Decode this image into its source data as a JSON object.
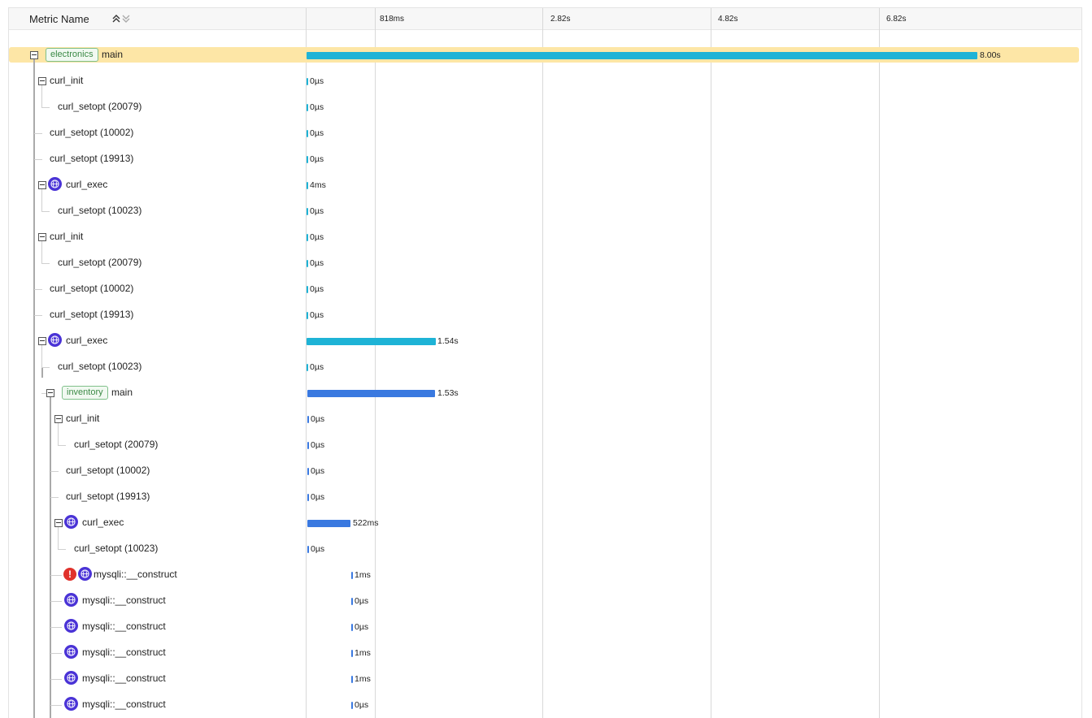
{
  "header": {
    "column_label": "Metric Name",
    "ticks": [
      "818ms",
      "2.82s",
      "4.82s",
      "6.82s"
    ]
  },
  "colors": {
    "bar_primary": "#1eb3d6",
    "bar_secondary": "#3a79e0",
    "highlight": "#fde6a6",
    "tag": "#7fc08a"
  },
  "rows": [
    {
      "tag": "electronics",
      "label": "main",
      "duration": "8.00s"
    },
    {
      "label": "curl_init",
      "duration": "0µs"
    },
    {
      "label": "curl_setopt (20079)",
      "duration": "0µs"
    },
    {
      "label": "curl_setopt (10002)",
      "duration": "0µs"
    },
    {
      "label": "curl_setopt (19913)",
      "duration": "0µs"
    },
    {
      "icon": "globe-icon",
      "label": "curl_exec",
      "duration": "4ms"
    },
    {
      "label": "curl_setopt (10023)",
      "duration": "0µs"
    },
    {
      "label": "curl_init",
      "duration": "0µs"
    },
    {
      "label": "curl_setopt (20079)",
      "duration": "0µs"
    },
    {
      "label": "curl_setopt (10002)",
      "duration": "0µs"
    },
    {
      "label": "curl_setopt (19913)",
      "duration": "0µs"
    },
    {
      "icon": "globe-icon",
      "label": "curl_exec",
      "duration": "1.54s"
    },
    {
      "label": "curl_setopt (10023)",
      "duration": "0µs"
    },
    {
      "tag": "inventory",
      "label": "main",
      "duration": "1.53s"
    },
    {
      "label": "curl_init",
      "duration": "0µs"
    },
    {
      "label": "curl_setopt (20079)",
      "duration": "0µs"
    },
    {
      "label": "curl_setopt (10002)",
      "duration": "0µs"
    },
    {
      "label": "curl_setopt (19913)",
      "duration": "0µs"
    },
    {
      "icon": "globe-icon",
      "label": "curl_exec",
      "duration": "522ms"
    },
    {
      "label": "curl_setopt (10023)",
      "duration": "0µs"
    },
    {
      "icon": "error-icon",
      "icon2": "globe-icon",
      "label": "mysqli::__construct",
      "duration": "1ms"
    },
    {
      "icon": "globe-icon",
      "label": "mysqli::__construct",
      "duration": "0µs"
    },
    {
      "icon": "globe-icon",
      "label": "mysqli::__construct",
      "duration": "0µs"
    },
    {
      "icon": "globe-icon",
      "label": "mysqli::__construct",
      "duration": "1ms"
    },
    {
      "icon": "globe-icon",
      "label": "mysqli::__construct",
      "duration": "1ms"
    },
    {
      "icon": "globe-icon",
      "label": "mysqli::__construct",
      "duration": "0µs"
    }
  ]
}
